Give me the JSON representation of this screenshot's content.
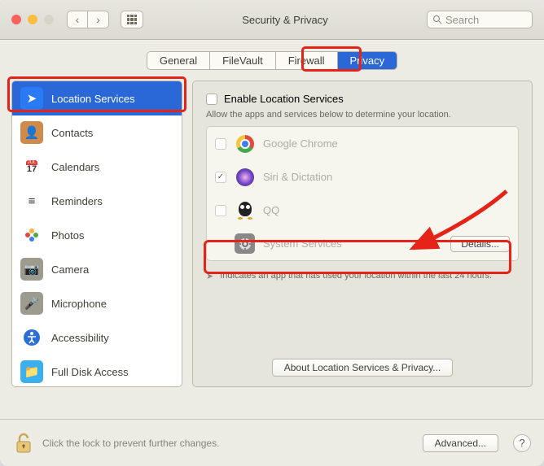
{
  "window": {
    "title": "Security & Privacy"
  },
  "search": {
    "placeholder": "Search"
  },
  "tabs": [
    {
      "label": "General",
      "active": false
    },
    {
      "label": "FileVault",
      "active": false
    },
    {
      "label": "Firewall",
      "active": false
    },
    {
      "label": "Privacy",
      "active": true
    }
  ],
  "sidebar": {
    "items": [
      {
        "label": "Location Services",
        "selected": true,
        "iconBg": "#2a7af6",
        "iconColor": "#fff",
        "glyph": "➤"
      },
      {
        "label": "Contacts",
        "iconBg": "#d08a4a",
        "iconColor": "#fff",
        "glyph": "👤"
      },
      {
        "label": "Calendars",
        "iconBg": "#fff",
        "iconColor": "#e03a2f",
        "glyph": "17"
      },
      {
        "label": "Reminders",
        "iconBg": "#fff",
        "iconColor": "#333",
        "glyph": "≡"
      },
      {
        "label": "Photos",
        "iconBg": "#fff",
        "iconColor": "#333",
        "glyph": "✿"
      },
      {
        "label": "Camera",
        "iconBg": "#9d9b8e",
        "iconColor": "#fff",
        "glyph": "📷"
      },
      {
        "label": "Microphone",
        "iconBg": "#9d9b8e",
        "iconColor": "#fff",
        "glyph": "🎤"
      },
      {
        "label": "Accessibility",
        "iconBg": "#fff",
        "iconColor": "#2a6edc",
        "glyph": "◉"
      },
      {
        "label": "Full Disk Access",
        "iconBg": "#3bb0f0",
        "iconColor": "#fff",
        "glyph": "📁"
      }
    ]
  },
  "main": {
    "enable_label": "Enable Location Services",
    "enable_checked": false,
    "hint": "Allow the apps and services below to determine your location.",
    "apps": [
      {
        "label": "Google Chrome",
        "checked": false,
        "showCheckbox": true
      },
      {
        "label": "Siri & Dictation",
        "checked": true,
        "showCheckbox": true
      },
      {
        "label": "QQ",
        "checked": false,
        "showCheckbox": true
      },
      {
        "label": "System Services",
        "checked": false,
        "showCheckbox": false,
        "details": true
      }
    ],
    "details_label": "Details...",
    "indicator_text": "Indicates an app that has used your location within the last 24 hours.",
    "about_label": "About Location Services & Privacy..."
  },
  "footer": {
    "lock_text": "Click the lock to prevent further changes.",
    "advanced_label": "Advanced...",
    "help_label": "?"
  }
}
